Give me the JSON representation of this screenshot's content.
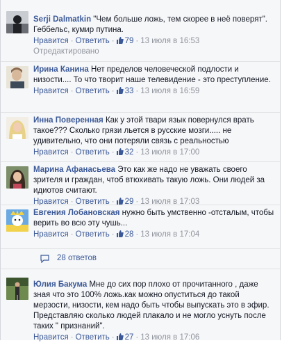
{
  "comments": [
    {
      "author": "Serji Dalmatkin",
      "text": "\"Чем больше ложь, тем скорее в неё поверят\". Геббельс, кумир путина.",
      "like": "Нравится",
      "reply": "Ответить",
      "likes": "79",
      "time": "13 июля в 16:53",
      "edited": "Отредактировано"
    },
    {
      "author": "Ирина Канина",
      "text": "Нет пределов человеческой подлости и низости.... То что творит наше телевидение - это преступление.",
      "like": "Нравится",
      "reply": "Ответить",
      "likes": "33",
      "time": "13 июля в 16:59"
    },
    {
      "author": "Инна Поверенная",
      "text": "Как у этой твари язык повернулся врать такое??? Сколько грязи льется в русские мозги..... не удивительно, что они потеряли связь с реальностью",
      "like": "Нравится",
      "reply": "Ответить",
      "likes": "32",
      "time": "13 июля в 17:00"
    },
    {
      "author": "Марина Афанасьева",
      "text": "Это как же надо не уважать своего зрителя и граждан, чтоб втюхивать такую ложь. Они людей за идиотов считают.",
      "like": "Нравится",
      "reply": "Ответить",
      "likes": "29",
      "time": "13 июля в 17:03"
    },
    {
      "author": "Евгения Лобановская",
      "text": "нужно быть умственно -отсталым, чтобы верить во всю эту чушь...",
      "like": "Нравится",
      "reply": "Ответить",
      "likes": "28",
      "time": "13 июля в 17:04"
    },
    {
      "author": "Юлия Бакума",
      "text": "Мне до сих пор плохо от прочитанного , даже зная что это 100% ложь.как можно опуститься до такой мерзости, низости, кем надо быть чтобы выпускать это в эфир. Представляю сколько людей плакало и не могло уснуть после таких \" признаний\".",
      "like": "Нравится",
      "reply": "Ответить",
      "likes": "27",
      "time": "13 июля в 17:06"
    }
  ],
  "replies": {
    "label": "28 ответов",
    "icon": "speech-bubble-icon"
  },
  "colors": {
    "link": "#3b5998",
    "meta": "#90949c",
    "background": "#f6f7f9"
  }
}
